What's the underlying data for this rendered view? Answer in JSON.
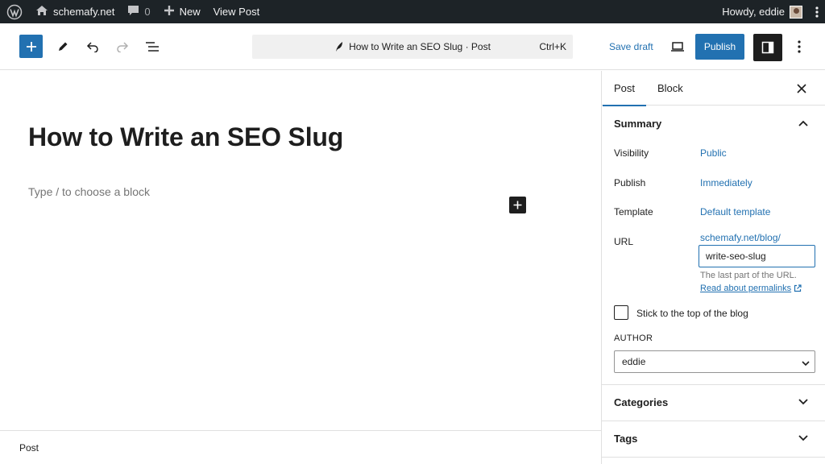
{
  "adminbar": {
    "wp_icon": "wordpress-icon",
    "site_name": "schemafy.net",
    "comments_count": "0",
    "new_label": "New",
    "view_post_label": "View Post",
    "greeting": "Howdy, eddie"
  },
  "toolbar": {
    "inserter_icon": "plus-icon",
    "tools_icon": "pencil-icon",
    "undo_icon": "undo-icon",
    "redo_icon": "redo-icon",
    "list_view_icon": "list-view-icon",
    "command_title": "How to Write an SEO Slug · Post",
    "command_shortcut": "Ctrl+K",
    "save_draft_label": "Save draft",
    "publish_label": "Publish"
  },
  "editor": {
    "post_title": "How to Write an SEO Slug",
    "block_placeholder": "Type / to choose a block",
    "footer_label": "Post"
  },
  "sidebar": {
    "tabs": [
      {
        "label": "Post",
        "active": true
      },
      {
        "label": "Block",
        "active": false
      }
    ],
    "summary_title": "Summary",
    "rows": [
      {
        "label": "Visibility",
        "value": "Public"
      },
      {
        "label": "Publish",
        "value": "Immediately"
      },
      {
        "label": "Template",
        "value": "Default template"
      }
    ],
    "url": {
      "label": "URL",
      "prefix": "schemafy.net/blog/",
      "slug": "write-seo-slug",
      "hint": "The last part of the URL.",
      "link_text": "Read about permalinks"
    },
    "sticky_label": "Stick to the top of the blog",
    "sticky_checked": false,
    "author_label": "AUTHOR",
    "author_value": "eddie",
    "categories_title": "Categories",
    "tags_title": "Tags"
  },
  "colors": {
    "accent": "#2271b1",
    "admin_bar": "#1d2327",
    "dark": "#1e1e1e"
  }
}
